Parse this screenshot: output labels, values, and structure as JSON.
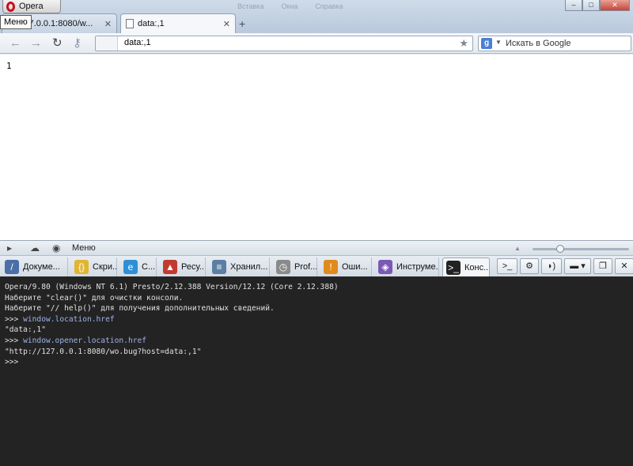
{
  "window": {
    "opera_button": "Opera",
    "menu_tooltip": "Меню",
    "ghost_menu": [
      "Вставка",
      "Окна",
      "Справка"
    ],
    "controls": {
      "minimize": "–",
      "maximize": "□",
      "close": "✕"
    }
  },
  "tabs": [
    {
      "title": "p://127.0.0.1:8080/w...",
      "close": "✕"
    },
    {
      "title": "data:,1",
      "close": "✕"
    }
  ],
  "newtab_symbol": "+",
  "navbar": {
    "back": "←",
    "forward": "→",
    "reload": "↻",
    "key": "⚷",
    "address": "data:,1",
    "star": "★",
    "search_engine": "g",
    "search_placeholder": "Искать в Google"
  },
  "page": {
    "content": "1"
  },
  "devtools": {
    "menu_label": "Меню",
    "header_icons": {
      "dock": "▸",
      "cloud": "☁",
      "camera": "◉"
    },
    "tabs": [
      {
        "label": "Докуме...",
        "color": "#4a6fa8",
        "glyph": "/"
      },
      {
        "label": "Скри...",
        "color": "#e0b530",
        "glyph": "{}"
      },
      {
        "label": "С...",
        "color": "#2d8fd6",
        "glyph": "e"
      },
      {
        "label": "Ресу...",
        "color": "#c23a2f",
        "glyph": "▲"
      },
      {
        "label": "Хранил...",
        "color": "#5b7fa3",
        "glyph": "≡"
      },
      {
        "label": "Prof...",
        "color": "#8a8a8a",
        "glyph": "◷"
      },
      {
        "label": "Оши...",
        "color": "#e08a1c",
        "glyph": "!"
      },
      {
        "label": "Инструме...",
        "color": "#7b59b3",
        "glyph": "◈"
      },
      {
        "label": "Конс...",
        "color": "#222222",
        "glyph": ">_"
      }
    ],
    "tool_buttons": {
      "console": ">_",
      "settings": "⚙",
      "speech": "◗)",
      "docking": "▬ ▾",
      "undock": "❐",
      "close": "✕"
    }
  },
  "console": {
    "lines": [
      {
        "text": "Opera/9.80 (Windows NT 6.1) Presto/2.12.388 Version/12.12 (Core 2.12.388)"
      },
      {
        "text": "Наберите \"clear()\" для очистки консоли."
      },
      {
        "text": "Наберите \"// help()\" для получения дополнительных сведений."
      },
      {
        "prompt": ">>> ",
        "code": "window.location.href"
      },
      {
        "text": "\"data:,1\""
      },
      {
        "prompt": ">>> ",
        "code": "window.opener.location.href"
      },
      {
        "text": "\"http://127.0.0.1:8080/wo.bug?host=data:,1\""
      },
      {
        "prompt": ">>>",
        "code": ""
      }
    ]
  }
}
